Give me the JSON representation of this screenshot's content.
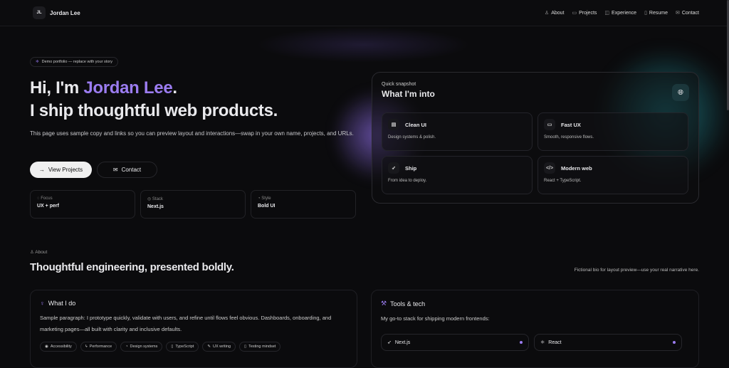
{
  "nav": {
    "initials": "JL",
    "brand": "Jordan Lee",
    "links": [
      {
        "label": "About",
        "icon": "user-icon"
      },
      {
        "label": "Projects",
        "icon": "folder-icon"
      },
      {
        "label": "Experience",
        "icon": "briefcase-icon"
      },
      {
        "label": "Resume",
        "icon": "file-icon"
      },
      {
        "label": "Contact",
        "icon": "mail-icon"
      }
    ]
  },
  "hero": {
    "pill": "Demo portfolio — replace with your story",
    "greeting": "Hi, I'm ",
    "name": "Jordan Lee",
    "period": ".",
    "tagline": "I ship thoughtful web products.",
    "lead": "This page uses sample copy and links so you can preview layout and interactions—swap in your own name, projects, and URLs.",
    "primary_button": "View Projects",
    "secondary_button": "Contact",
    "stats": [
      {
        "label": "Focus",
        "value": "UX + perf"
      },
      {
        "label": "Stack",
        "value": "Next.js"
      },
      {
        "label": "Style",
        "value": "Bold UI"
      }
    ]
  },
  "snapshot": {
    "subtitle": "Quick snapshot",
    "title": "What I'm into",
    "items": [
      {
        "title": "Clean UI",
        "desc": "Design systems & polish."
      },
      {
        "title": "Fast UX",
        "desc": "Smooth, responsive flows."
      },
      {
        "title": "Ship",
        "desc": "From idea to deploy."
      },
      {
        "title": "Modern web",
        "desc": "React + TypeScript."
      }
    ]
  },
  "about": {
    "label": "About",
    "heading": "Thoughtful engineering, presented boldly.",
    "bio": "Fictional bio for layout preview—use your real narrative here.",
    "what": {
      "title": "What I do",
      "text": "Sample paragraph: I prototype quickly, validate with users, and refine until flows feel obvious. Dashboards, onboarding, and marketing pages—all built with clarity and inclusive defaults.",
      "tags": [
        "Accessibility",
        "Performance",
        "Design systems",
        "TypeScript",
        "UX writing",
        "Testing mindset"
      ]
    },
    "tools": {
      "title": "Tools & tech",
      "text": "My go-to stack for shipping modern frontends:",
      "items": [
        "Next.js",
        "React"
      ]
    }
  },
  "colors": {
    "accent": "#9b7cf0",
    "background": "#0b0b0d"
  }
}
